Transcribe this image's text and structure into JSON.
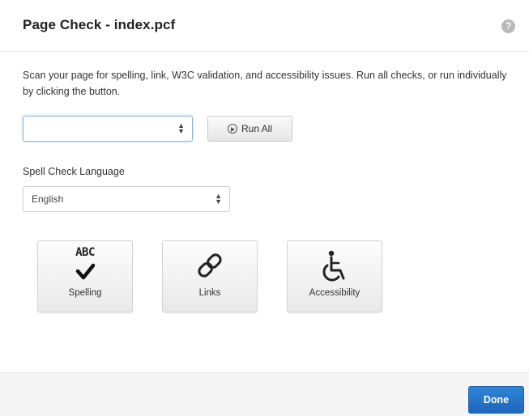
{
  "dialog": {
    "title": "Page Check - index.pcf",
    "help_icon": "question-icon",
    "description": "Scan your page for spelling, link, W3C validation, and accessibility issues. Run all checks, or run individually by clicking the button.",
    "checks_select": {
      "value": ""
    },
    "run_all_label": "Run All",
    "spell_check_language_label": "Spell Check Language",
    "language_select": {
      "value": "English"
    },
    "tools": [
      {
        "label": "Spelling",
        "icon": "spelling-abc-check-icon",
        "icon_text": "ABC"
      },
      {
        "label": "Links",
        "icon": "link-icon"
      },
      {
        "label": "Accessibility",
        "icon": "wheelchair-icon"
      }
    ],
    "done_label": "Done"
  },
  "colors": {
    "accent": "#2a78c9",
    "focus_border": "#8fb3d9",
    "footer_bg": "#f5f5f5"
  }
}
